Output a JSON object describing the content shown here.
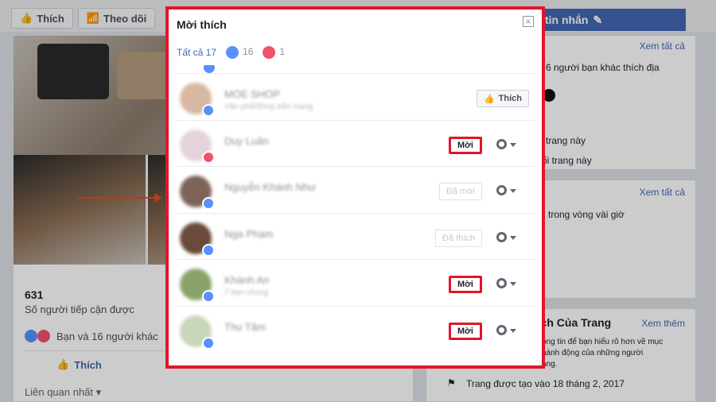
{
  "page_toolbar": {
    "like_label": "Thích",
    "follow_label": "Theo dõi",
    "message_label": "tin nhắn"
  },
  "post": {
    "reach_number": "631",
    "reach_label": "Số người tiếp cận được",
    "reactions_text": "Bạn và 16 người khác",
    "like_action": "Thích",
    "related_sort": "Liên quan nhất"
  },
  "right_column": {
    "see_all_1": "Xem tất cả",
    "friends_like_text": "6 người bạn khác thích địa",
    "page_line_1": "trang này",
    "page_line_2": "ối trang này",
    "see_all_2": "Xem tất cả",
    "response_text": "i trong vòng vài giờ",
    "history_title": "nch Của Trang",
    "see_more": "Xem thêm",
    "history_desc_1": "ông tin để bạn hiểu rõ hơn về mục",
    "history_desc_2": "hành động của những người",
    "history_desc_3": "ang.",
    "created_text": "Trang được tạo vào 18 tháng 2, 2017"
  },
  "modal": {
    "title": "Mời thích",
    "close_icon": "close-icon",
    "tabs": {
      "all": "Tất cả 17",
      "like_count": "16",
      "love_count": "1"
    },
    "people": [
      {
        "name": "MOE SHOP",
        "sub": "Vân phố/Shop trên mạng",
        "avatar": "#d8b8a0",
        "reaction": "like",
        "action": "Thích",
        "state": "like-page"
      },
      {
        "name": "Duy Luân",
        "sub": "",
        "avatar": "#e5d3dc",
        "reaction": "love",
        "action": "Mời",
        "state": "invite"
      },
      {
        "name": "Nguyễn Khánh Như",
        "sub": "",
        "avatar": "#7d6457",
        "reaction": "like",
        "action": "Đã mời",
        "state": "done"
      },
      {
        "name": "Nga Phạm",
        "sub": "",
        "avatar": "#6a4a3a",
        "reaction": "like",
        "action": "Đã thích",
        "state": "done"
      },
      {
        "name": "Khánh An",
        "sub": "7 bạn chung",
        "avatar": "#8aa36b",
        "reaction": "like",
        "action": "Mời",
        "state": "invite"
      },
      {
        "name": "Thu Tâm",
        "sub": "",
        "avatar": "#c9d6b8",
        "reaction": "like",
        "action": "Mời",
        "state": "invite"
      }
    ]
  }
}
